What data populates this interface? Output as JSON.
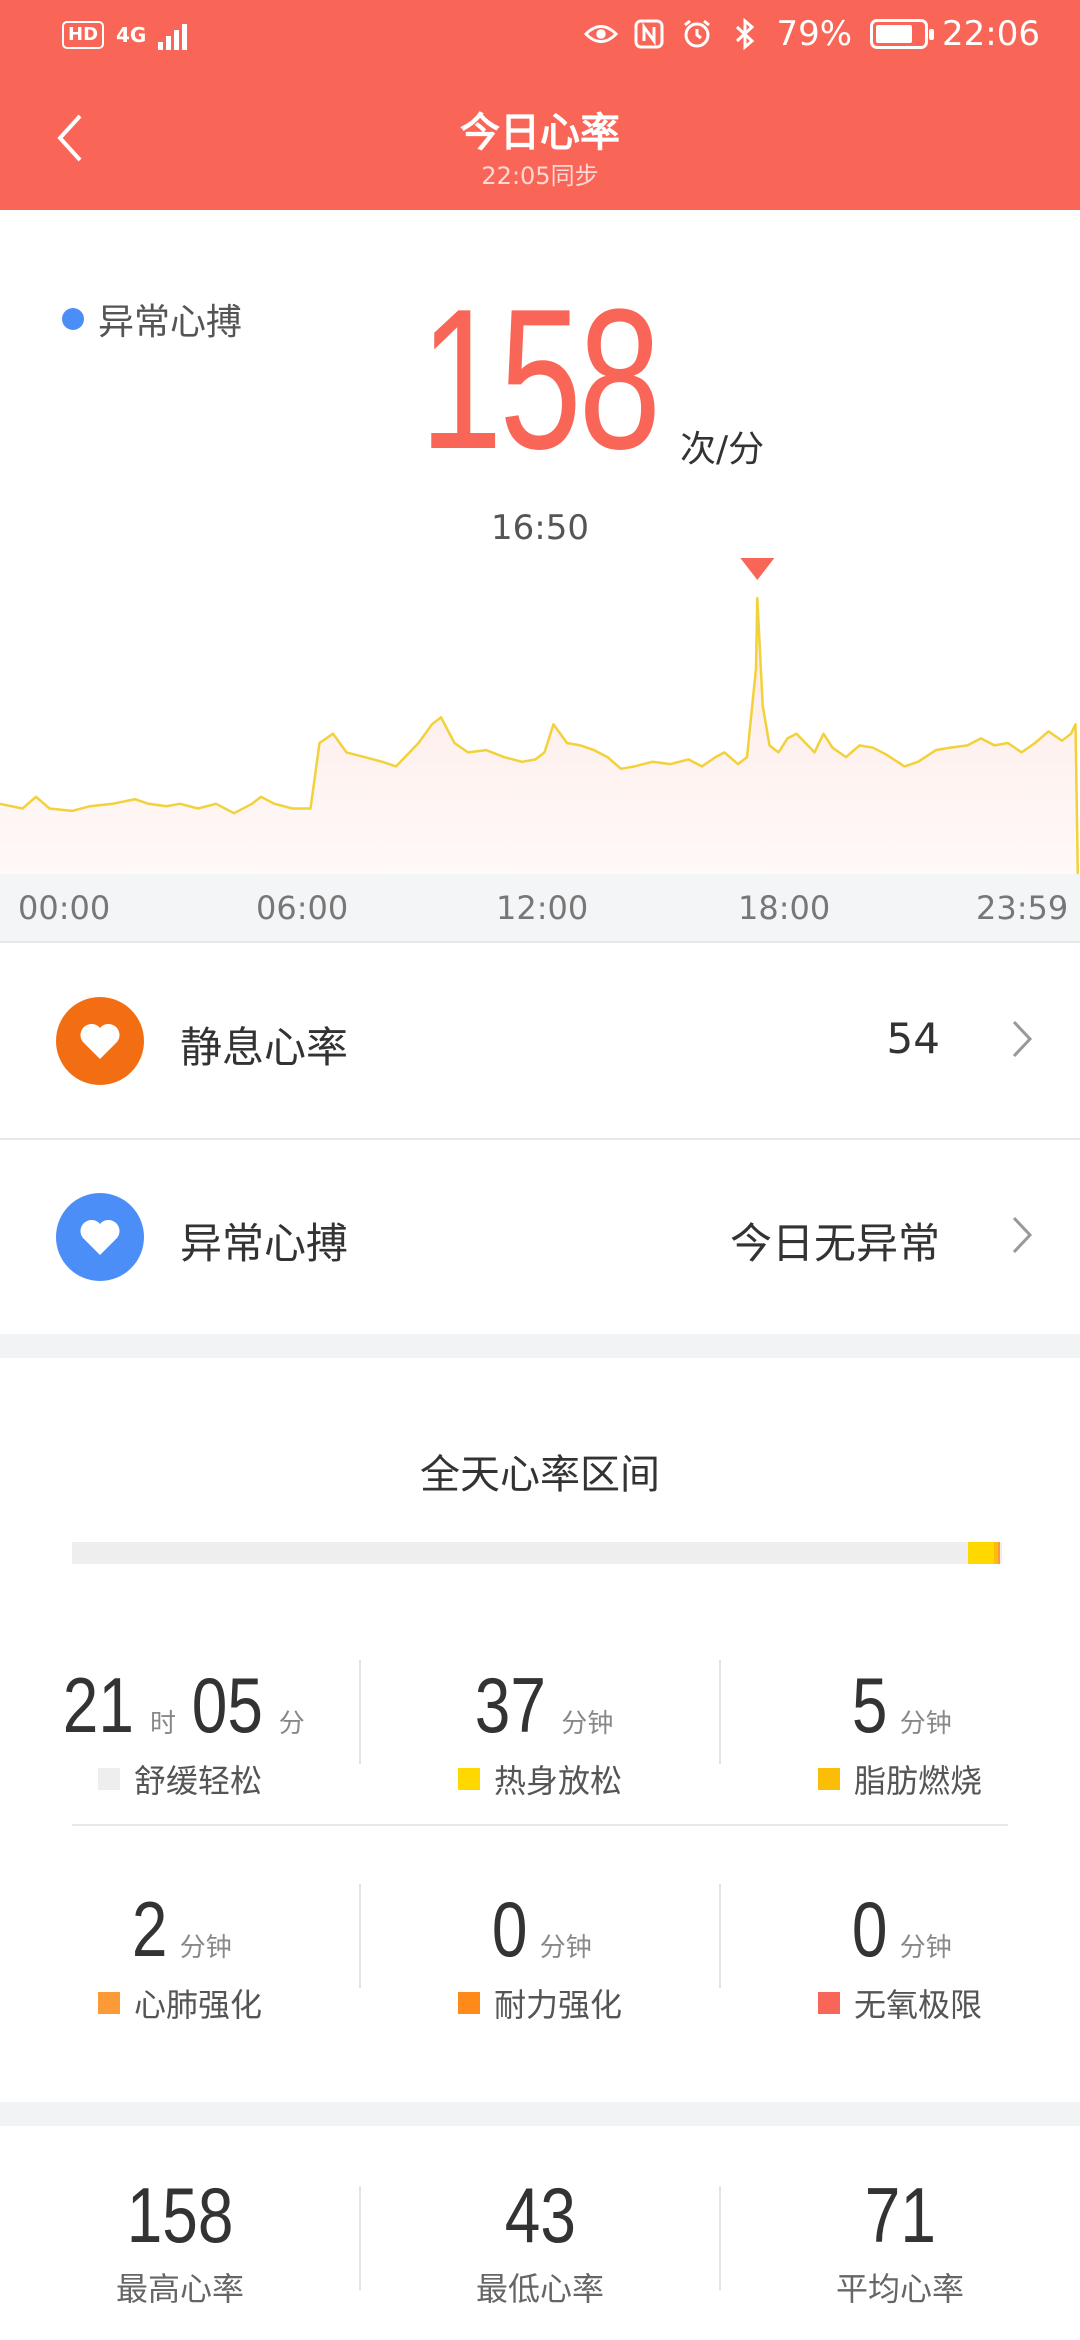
{
  "status_bar": {
    "hd": "HD",
    "network": "4G",
    "battery": "79%",
    "time": "22:06",
    "icons": [
      "eye-icon",
      "nfc-icon",
      "alarm-icon",
      "bluetooth-icon"
    ]
  },
  "header": {
    "title": "今日心率",
    "subtitle": "22:05同步",
    "bg_color": "#f96556"
  },
  "highlight": {
    "legend_label": "异常心搏",
    "legend_color": "#4b8ef7",
    "value": "158",
    "unit": "次/分",
    "time": "16:50"
  },
  "chart_data": {
    "type": "line",
    "x_tick_labels": [
      "00:00",
      "06:00",
      "12:00",
      "18:00",
      "23:59"
    ],
    "x_unit": "hours",
    "xlim": [
      0,
      24
    ],
    "ylim": [
      40,
      170
    ],
    "line_color": "#f2d13a",
    "peak": {
      "x": 16.83,
      "y": 158
    },
    "series": [
      {
        "points": [
          [
            0.0,
            70
          ],
          [
            0.5,
            68
          ],
          [
            0.8,
            73
          ],
          [
            1.1,
            68
          ],
          [
            1.6,
            67
          ],
          [
            2.0,
            69
          ],
          [
            2.5,
            70
          ],
          [
            3.0,
            72
          ],
          [
            3.3,
            70
          ],
          [
            3.7,
            69
          ],
          [
            4.0,
            70
          ],
          [
            4.4,
            68
          ],
          [
            4.8,
            70
          ],
          [
            5.2,
            66
          ],
          [
            5.6,
            70
          ],
          [
            5.8,
            73
          ],
          [
            6.1,
            70
          ],
          [
            6.5,
            68
          ],
          [
            6.9,
            68
          ],
          [
            7.1,
            96
          ],
          [
            7.4,
            100
          ],
          [
            7.7,
            92
          ],
          [
            8.1,
            90
          ],
          [
            8.5,
            88
          ],
          [
            8.8,
            86
          ],
          [
            9.0,
            90
          ],
          [
            9.3,
            96
          ],
          [
            9.6,
            104
          ],
          [
            9.8,
            107
          ],
          [
            10.1,
            96
          ],
          [
            10.4,
            92
          ],
          [
            10.8,
            93
          ],
          [
            11.2,
            90
          ],
          [
            11.6,
            88
          ],
          [
            11.9,
            89
          ],
          [
            12.1,
            92
          ],
          [
            12.3,
            104
          ],
          [
            12.6,
            96
          ],
          [
            12.9,
            95
          ],
          [
            13.2,
            93
          ],
          [
            13.5,
            90
          ],
          [
            13.8,
            85
          ],
          [
            14.1,
            86
          ],
          [
            14.5,
            88
          ],
          [
            14.9,
            87
          ],
          [
            15.3,
            89
          ],
          [
            15.6,
            86
          ],
          [
            15.9,
            90
          ],
          [
            16.1,
            92
          ],
          [
            16.4,
            87
          ],
          [
            16.6,
            90
          ],
          [
            16.8,
            128
          ],
          [
            16.83,
            158
          ],
          [
            16.95,
            112
          ],
          [
            17.1,
            95
          ],
          [
            17.3,
            92
          ],
          [
            17.5,
            98
          ],
          [
            17.7,
            100
          ],
          [
            17.9,
            96
          ],
          [
            18.1,
            92
          ],
          [
            18.3,
            100
          ],
          [
            18.5,
            94
          ],
          [
            18.8,
            90
          ],
          [
            19.1,
            95
          ],
          [
            19.4,
            94
          ],
          [
            19.7,
            91
          ],
          [
            20.1,
            86
          ],
          [
            20.4,
            88
          ],
          [
            20.8,
            93
          ],
          [
            21.1,
            94
          ],
          [
            21.5,
            95
          ],
          [
            21.8,
            98
          ],
          [
            22.1,
            95
          ],
          [
            22.4,
            96
          ],
          [
            22.7,
            92
          ],
          [
            23.0,
            96
          ],
          [
            23.3,
            101
          ],
          [
            23.6,
            97
          ],
          [
            23.8,
            100
          ],
          [
            23.9,
            104
          ],
          [
            23.95,
            40
          ]
        ]
      }
    ]
  },
  "rows": [
    {
      "label": "静息心率",
      "value": "54",
      "icon_color": "#f36e13"
    },
    {
      "label": "异常心搏",
      "value": "今日无异常",
      "icon_color": "#4b8ef7"
    }
  ],
  "zones": {
    "title": "全天心率区间",
    "bar_fractions": [
      0.9634,
      0.0282,
      0.0038,
      0.0015,
      0.0,
      0.0
    ],
    "colors": [
      "#eeeeee",
      "#ffd800",
      "#fbbd08",
      "#fd9a38",
      "#ff8a1a",
      "#f96556"
    ],
    "items": [
      {
        "parts": [
          {
            "num": "21",
            "unit": "时"
          },
          {
            "num": "05",
            "unit": "分"
          }
        ],
        "label": "舒缓轻松"
      },
      {
        "parts": [
          {
            "num": "37",
            "unit": "分钟"
          }
        ],
        "label": "热身放松"
      },
      {
        "parts": [
          {
            "num": "5",
            "unit": "分钟"
          }
        ],
        "label": "脂肪燃烧"
      },
      {
        "parts": [
          {
            "num": "2",
            "unit": "分钟"
          }
        ],
        "label": "心肺强化"
      },
      {
        "parts": [
          {
            "num": "0",
            "unit": "分钟"
          }
        ],
        "label": "耐力强化"
      },
      {
        "parts": [
          {
            "num": "0",
            "unit": "分钟"
          }
        ],
        "label": "无氧极限"
      }
    ]
  },
  "summary": [
    {
      "value": "158",
      "label": "最高心率"
    },
    {
      "value": "43",
      "label": "最低心率"
    },
    {
      "value": "71",
      "label": "平均心率"
    }
  ]
}
